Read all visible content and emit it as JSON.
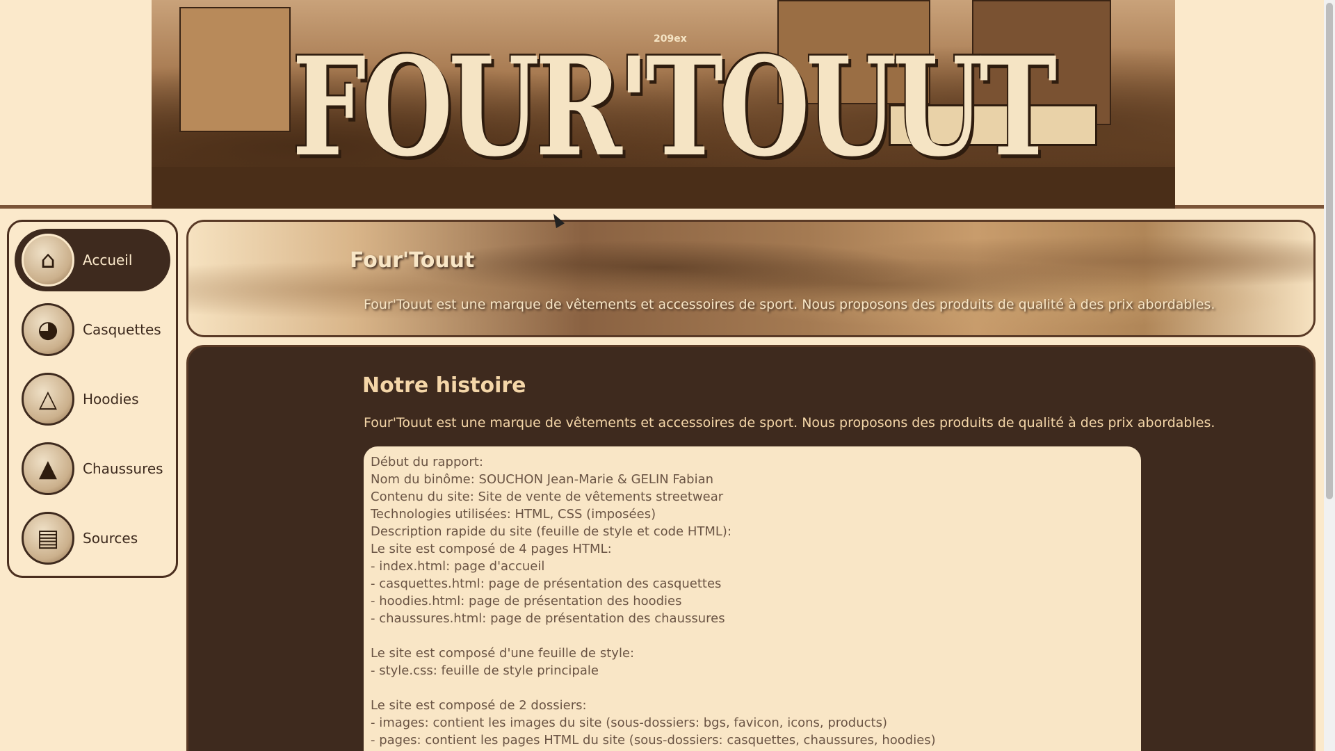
{
  "banner": {
    "logo_text": "FOUR'TOUUT",
    "logo_tag": "209ex"
  },
  "sidebar": {
    "items": [
      {
        "label": "Accueil",
        "icon": "house-sneaker-icon",
        "active": true
      },
      {
        "label": "Casquettes",
        "icon": "cap-icon",
        "active": false
      },
      {
        "label": "Hoodies",
        "icon": "hoodie-icon",
        "active": false
      },
      {
        "label": "Chaussures",
        "icon": "sneaker-icon",
        "active": false
      },
      {
        "label": "Sources",
        "icon": "document-icon",
        "active": false
      }
    ]
  },
  "hero": {
    "title": "Four'Touut",
    "text": "Four'Touut est une marque de vêtements et accessoires de sport. Nous proposons des produits de qualité à des prix abordables."
  },
  "main": {
    "title": "Notre histoire",
    "text": "Four'Touut est une marque de vêtements et accessoires de sport. Nous proposons des produits de qualité à des prix abordables.",
    "report_lines": [
      "Début du rapport:",
      "Nom du binôme: SOUCHON Jean-Marie & GELIN Fabian",
      "Contenu du site: Site de vente de vêtements streetwear",
      "Technologies utilisées: HTML, CSS (imposées)",
      "Description rapide du site (feuille de style et code HTML):",
      "Le site est composé de 4 pages HTML:",
      "- index.html: page d'accueil",
      "- casquettes.html: page de présentation des casquettes",
      "- hoodies.html: page de présentation des hoodies",
      "- chaussures.html: page de présentation des chaussures",
      "",
      "Le site est composé d'une feuille de style:",
      "- style.css: feuille de style principale",
      "",
      "Le site est composé de 2 dossiers:",
      "- images: contient les images du site (sous-dossiers: bgs, favicon, icons, products)",
      "- pages: contient les pages HTML du site (sous-dossiers: casquettes, chaussures, hoodies)"
    ]
  },
  "colors": {
    "background": "#fbe9cb",
    "dark_brown": "#3e2a1e",
    "accent_text": "#f4d6a8"
  }
}
